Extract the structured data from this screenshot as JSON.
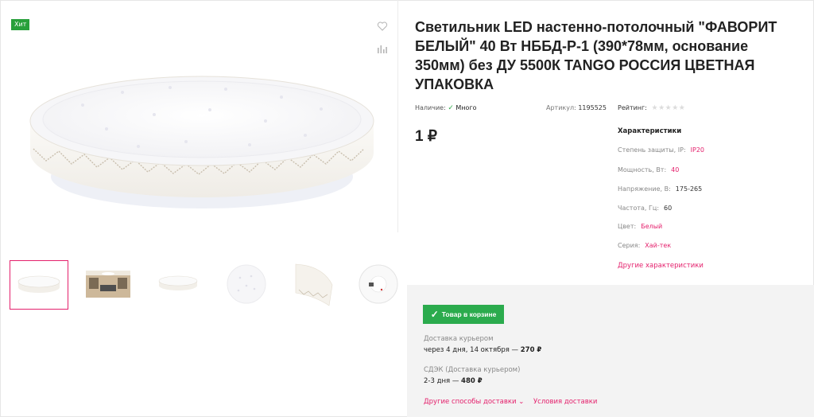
{
  "badge": "Хит",
  "product": {
    "title": "Светильник LED настенно-потолочный \"ФАВОРИТ БЕЛЫЙ\" 40 Вт НББД-Р-1 (390*78мм, основание 350мм) без ДУ 5500К TANGO РОССИЯ ЦВЕТНАЯ УПАКОВКА",
    "availability_label": "Наличие:",
    "availability_value": "Много",
    "article_label": "Артикул:",
    "article_value": "1195525",
    "rating_label": "Рейтинг:",
    "rating_value": 0,
    "price": "1 ₽"
  },
  "characteristics": {
    "title": "Характеристики",
    "rows": [
      {
        "label": "Степень защиты, IP:",
        "value": "IP20"
      },
      {
        "label": "Мощность, Вт:",
        "value": "40"
      },
      {
        "label": "Напряжение, В:",
        "value": "175-265"
      },
      {
        "label": "Частота, Гц:",
        "value": "60"
      },
      {
        "label": "Цвет:",
        "value": "Белый"
      },
      {
        "label": "Серия:",
        "value": "Хай-тек"
      }
    ],
    "more_link": "Другие характеристики"
  },
  "cart": {
    "button_label": "Товар в корзине"
  },
  "delivery": [
    {
      "label": "Доставка курьером",
      "value": "через 4 дня, 14 октября —",
      "price": "270 ₽"
    },
    {
      "label": "СДЭК (Доставка курьером)",
      "value": "2-3 дня —",
      "price": "480 ₽"
    }
  ],
  "links": {
    "other_delivery": "Другие способы доставки",
    "delivery_terms": "Условия доставки"
  },
  "icons": [
    "heart-icon",
    "compare-icon",
    "check-icon",
    "star-icon",
    "chevron-down-icon"
  ],
  "colors": {
    "accent": "#e4206c",
    "green": "#2bab4d",
    "badge": "#28a03b"
  }
}
